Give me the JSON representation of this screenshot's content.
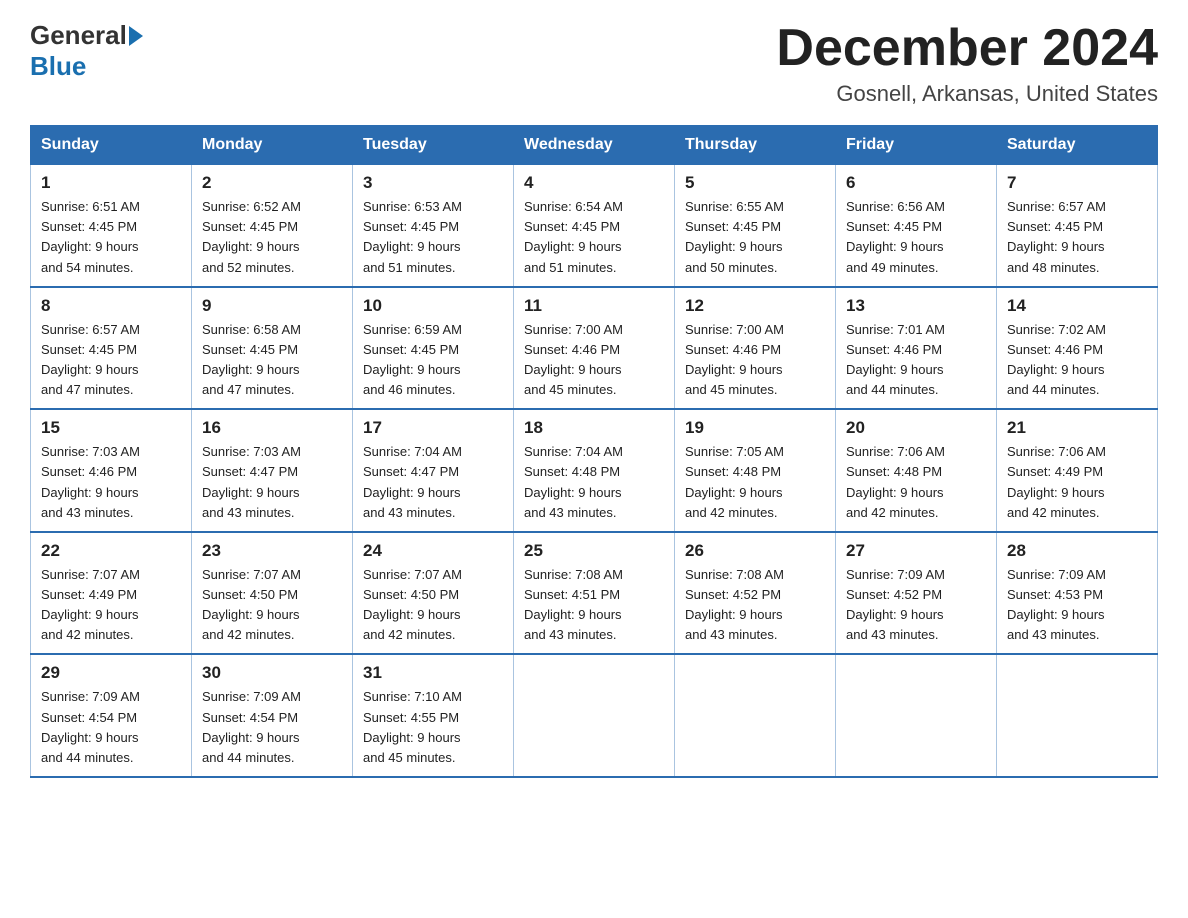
{
  "logo": {
    "general": "General",
    "blue": "Blue"
  },
  "header": {
    "month_year": "December 2024",
    "location": "Gosnell, Arkansas, United States"
  },
  "weekdays": [
    "Sunday",
    "Monday",
    "Tuesday",
    "Wednesday",
    "Thursday",
    "Friday",
    "Saturday"
  ],
  "weeks": [
    [
      {
        "day": "1",
        "sunrise": "6:51 AM",
        "sunset": "4:45 PM",
        "daylight": "9 hours and 54 minutes."
      },
      {
        "day": "2",
        "sunrise": "6:52 AM",
        "sunset": "4:45 PM",
        "daylight": "9 hours and 52 minutes."
      },
      {
        "day": "3",
        "sunrise": "6:53 AM",
        "sunset": "4:45 PM",
        "daylight": "9 hours and 51 minutes."
      },
      {
        "day": "4",
        "sunrise": "6:54 AM",
        "sunset": "4:45 PM",
        "daylight": "9 hours and 51 minutes."
      },
      {
        "day": "5",
        "sunrise": "6:55 AM",
        "sunset": "4:45 PM",
        "daylight": "9 hours and 50 minutes."
      },
      {
        "day": "6",
        "sunrise": "6:56 AM",
        "sunset": "4:45 PM",
        "daylight": "9 hours and 49 minutes."
      },
      {
        "day": "7",
        "sunrise": "6:57 AM",
        "sunset": "4:45 PM",
        "daylight": "9 hours and 48 minutes."
      }
    ],
    [
      {
        "day": "8",
        "sunrise": "6:57 AM",
        "sunset": "4:45 PM",
        "daylight": "9 hours and 47 minutes."
      },
      {
        "day": "9",
        "sunrise": "6:58 AM",
        "sunset": "4:45 PM",
        "daylight": "9 hours and 47 minutes."
      },
      {
        "day": "10",
        "sunrise": "6:59 AM",
        "sunset": "4:45 PM",
        "daylight": "9 hours and 46 minutes."
      },
      {
        "day": "11",
        "sunrise": "7:00 AM",
        "sunset": "4:46 PM",
        "daylight": "9 hours and 45 minutes."
      },
      {
        "day": "12",
        "sunrise": "7:00 AM",
        "sunset": "4:46 PM",
        "daylight": "9 hours and 45 minutes."
      },
      {
        "day": "13",
        "sunrise": "7:01 AM",
        "sunset": "4:46 PM",
        "daylight": "9 hours and 44 minutes."
      },
      {
        "day": "14",
        "sunrise": "7:02 AM",
        "sunset": "4:46 PM",
        "daylight": "9 hours and 44 minutes."
      }
    ],
    [
      {
        "day": "15",
        "sunrise": "7:03 AM",
        "sunset": "4:46 PM",
        "daylight": "9 hours and 43 minutes."
      },
      {
        "day": "16",
        "sunrise": "7:03 AM",
        "sunset": "4:47 PM",
        "daylight": "9 hours and 43 minutes."
      },
      {
        "day": "17",
        "sunrise": "7:04 AM",
        "sunset": "4:47 PM",
        "daylight": "9 hours and 43 minutes."
      },
      {
        "day": "18",
        "sunrise": "7:04 AM",
        "sunset": "4:48 PM",
        "daylight": "9 hours and 43 minutes."
      },
      {
        "day": "19",
        "sunrise": "7:05 AM",
        "sunset": "4:48 PM",
        "daylight": "9 hours and 42 minutes."
      },
      {
        "day": "20",
        "sunrise": "7:06 AM",
        "sunset": "4:48 PM",
        "daylight": "9 hours and 42 minutes."
      },
      {
        "day": "21",
        "sunrise": "7:06 AM",
        "sunset": "4:49 PM",
        "daylight": "9 hours and 42 minutes."
      }
    ],
    [
      {
        "day": "22",
        "sunrise": "7:07 AM",
        "sunset": "4:49 PM",
        "daylight": "9 hours and 42 minutes."
      },
      {
        "day": "23",
        "sunrise": "7:07 AM",
        "sunset": "4:50 PM",
        "daylight": "9 hours and 42 minutes."
      },
      {
        "day": "24",
        "sunrise": "7:07 AM",
        "sunset": "4:50 PM",
        "daylight": "9 hours and 42 minutes."
      },
      {
        "day": "25",
        "sunrise": "7:08 AM",
        "sunset": "4:51 PM",
        "daylight": "9 hours and 43 minutes."
      },
      {
        "day": "26",
        "sunrise": "7:08 AM",
        "sunset": "4:52 PM",
        "daylight": "9 hours and 43 minutes."
      },
      {
        "day": "27",
        "sunrise": "7:09 AM",
        "sunset": "4:52 PM",
        "daylight": "9 hours and 43 minutes."
      },
      {
        "day": "28",
        "sunrise": "7:09 AM",
        "sunset": "4:53 PM",
        "daylight": "9 hours and 43 minutes."
      }
    ],
    [
      {
        "day": "29",
        "sunrise": "7:09 AM",
        "sunset": "4:54 PM",
        "daylight": "9 hours and 44 minutes."
      },
      {
        "day": "30",
        "sunrise": "7:09 AM",
        "sunset": "4:54 PM",
        "daylight": "9 hours and 44 minutes."
      },
      {
        "day": "31",
        "sunrise": "7:10 AM",
        "sunset": "4:55 PM",
        "daylight": "9 hours and 45 minutes."
      },
      null,
      null,
      null,
      null
    ]
  ],
  "labels": {
    "sunrise": "Sunrise:",
    "sunset": "Sunset:",
    "daylight": "Daylight:"
  }
}
